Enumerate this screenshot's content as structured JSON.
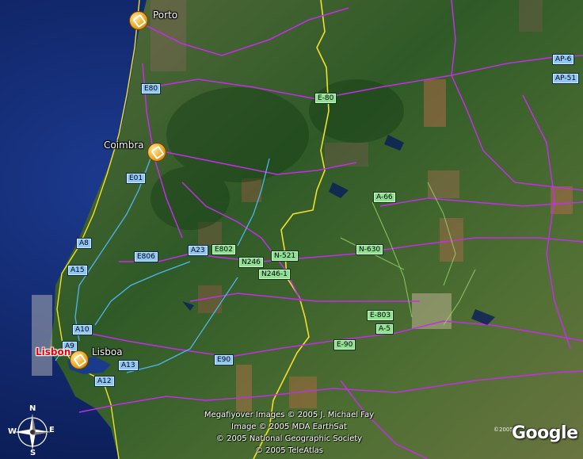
{
  "colors": {
    "ocean": "#0b1d5a",
    "land": "#3e6a2c",
    "motorway": "#c42ee8",
    "national_road": "#4fb6e8",
    "border": "#f2e12a",
    "minor_road": "#9fdb73"
  },
  "cities": [
    {
      "id": "porto",
      "label": "Porto"
    },
    {
      "id": "coimbra",
      "label": "Coimbra"
    },
    {
      "id": "lisboa",
      "label": "Lisboa"
    },
    {
      "id": "lisbon",
      "label": "Lisbon"
    }
  ],
  "road_shields": [
    {
      "label": "E80",
      "style": "blue"
    },
    {
      "label": "E-80",
      "style": "green"
    },
    {
      "label": "AP-6",
      "style": "blue"
    },
    {
      "label": "AP-51",
      "style": "blue"
    },
    {
      "label": "E01",
      "style": "blue"
    },
    {
      "label": "A-66",
      "style": "green"
    },
    {
      "label": "A8",
      "style": "blue"
    },
    {
      "label": "A23",
      "style": "blue"
    },
    {
      "label": "E802",
      "style": "green"
    },
    {
      "label": "N-521",
      "style": "green"
    },
    {
      "label": "N-630",
      "style": "green"
    },
    {
      "label": "E806",
      "style": "blue"
    },
    {
      "label": "N246",
      "style": "green"
    },
    {
      "label": "A15",
      "style": "blue"
    },
    {
      "label": "N246-1",
      "style": "green"
    },
    {
      "label": "E-803",
      "style": "green"
    },
    {
      "label": "A-5",
      "style": "green"
    },
    {
      "label": "A10",
      "style": "blue"
    },
    {
      "label": "E-90",
      "style": "green"
    },
    {
      "label": "A9",
      "style": "blue"
    },
    {
      "label": "E90",
      "style": "blue"
    },
    {
      "label": "A13",
      "style": "blue"
    },
    {
      "label": "A12",
      "style": "blue"
    }
  ],
  "credits": [
    "Megafiyover Images © 2005 J. Michael Fay",
    "Image © 2005 MDA EarthSat",
    "© 2005 National Geographic Society",
    "© 2005 TeleAtlas"
  ],
  "logo": {
    "text": "Google",
    "year": "©2005"
  },
  "compass": {
    "n": "N",
    "s": "S",
    "e": "E",
    "w": "W"
  }
}
